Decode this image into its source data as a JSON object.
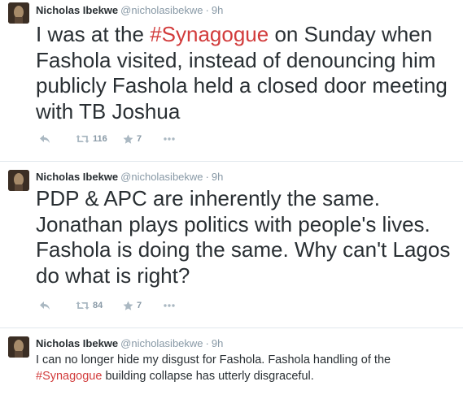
{
  "tweets": [
    {
      "name": "Nicholas Ibekwe",
      "handle": "@nicholasibekwe",
      "separator": "·",
      "time": "9h",
      "text_before": "I was at the ",
      "hashtag": "#Synagogue",
      "text_after": " on Sunday when Fashola visited, instead of denouncing him publicly Fashola held a closed door meeting with TB Joshua",
      "retweets": "116",
      "favorites": "7"
    },
    {
      "name": "Nicholas Ibekwe",
      "handle": "@nicholasibekwe",
      "separator": "·",
      "time": "9h",
      "text": "PDP & APC are inherently the same. Jonathan plays politics with people's lives. Fashola is doing the same. Why can't Lagos do what is right?",
      "retweets": "84",
      "favorites": "7"
    },
    {
      "name": "Nicholas Ibekwe",
      "handle": "@nicholasibekwe",
      "separator": "·",
      "time": "9h",
      "text_before": "I can no longer hide my disgust for Fashola. Fashola handling of the ",
      "hashtag": "#Synagogue",
      "text_after": " building collapse has utterly disgraceful."
    }
  ],
  "icons": [
    "reply-icon",
    "retweet-icon",
    "favorite-icon",
    "more-icon"
  ],
  "colors": {
    "hashtag": "#d23c3c",
    "muted": "#8899a6",
    "text": "#292f33",
    "divider": "#e1e8ed"
  }
}
